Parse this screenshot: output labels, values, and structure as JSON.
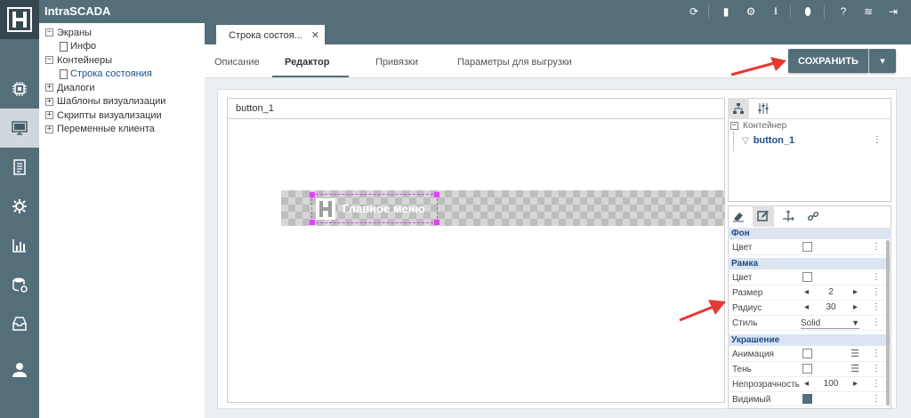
{
  "app": {
    "title": "IntraSCADA"
  },
  "colors": {
    "header": "#546e7a",
    "accent": "#e040fb",
    "section_bg": "#dbe4f0",
    "annotation_arrow": "#e53935"
  },
  "topbar": {
    "icons": [
      "refresh-icon",
      "tablet-icon",
      "gear-icon",
      "download-icon",
      "bug-icon",
      "help-icon",
      "wifi-icon",
      "logout-icon"
    ]
  },
  "leftnav": {
    "icons": [
      "chip-icon",
      "monitor-icon",
      "report-icon",
      "settings-icon",
      "bar-chart-icon",
      "database-icon",
      "archive-icon",
      "user-icon"
    ],
    "active_index": 1
  },
  "tree": {
    "items": [
      {
        "label": "Экраны",
        "toggle": "−",
        "level": 0
      },
      {
        "label": "Инфо",
        "level": 1
      },
      {
        "label": "Контейнеры",
        "toggle": "−",
        "level": 0
      },
      {
        "label": "Строка состояния",
        "level": 1,
        "selected": true
      },
      {
        "label": "Диалоги",
        "toggle": "+",
        "level": 0
      },
      {
        "label": "Шаблоны визуализации",
        "toggle": "+",
        "level": 0
      },
      {
        "label": "Скрипты визуализации",
        "toggle": "+",
        "level": 0
      },
      {
        "label": "Переменные клиента",
        "toggle": "+",
        "level": 0
      }
    ]
  },
  "doc_tab": {
    "label": "Строка состоя...",
    "close": "✕"
  },
  "subtabs": [
    "Описание",
    "Редактор",
    "Привязки",
    "Параметры для выгрузки"
  ],
  "save": {
    "label": "СОХРАНИТЬ",
    "dropdown": "▾"
  },
  "canvas": {
    "title": "button_1",
    "widget_label": "Главное меню"
  },
  "object_tree": {
    "root": "Контейнер",
    "child": "button_1"
  },
  "properties": {
    "sections": [
      {
        "title": "Фон",
        "rows": [
          {
            "label": "Цвет",
            "kind": "color"
          }
        ]
      },
      {
        "title": "Рамка",
        "rows": [
          {
            "label": "Цвет",
            "kind": "color"
          },
          {
            "label": "Размер",
            "kind": "stepper",
            "value": "2"
          },
          {
            "label": "Радиус",
            "kind": "stepper",
            "value": "30"
          },
          {
            "label": "Стиль",
            "kind": "select",
            "value": "Solid"
          }
        ]
      },
      {
        "title": "Украшение",
        "rows": [
          {
            "label": "Анимация",
            "kind": "check",
            "checked": false
          },
          {
            "label": "Тень",
            "kind": "check",
            "checked": false
          },
          {
            "label": "Непрозрачность",
            "kind": "stepper",
            "value": "100"
          },
          {
            "label": "Видимый",
            "kind": "check",
            "checked": true
          }
        ]
      }
    ]
  }
}
